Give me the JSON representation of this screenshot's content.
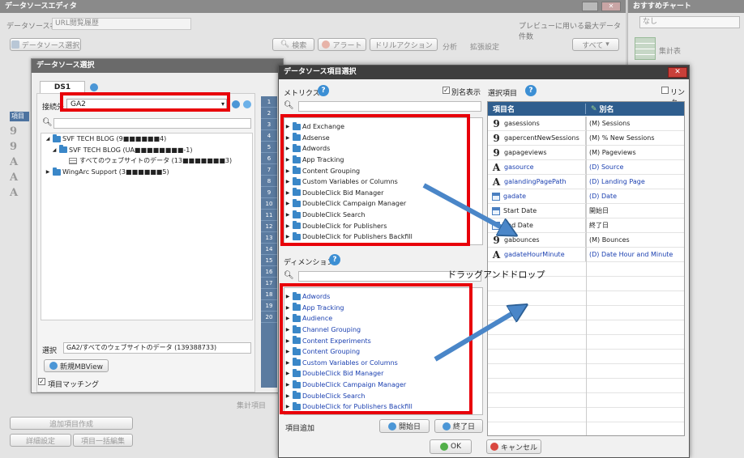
{
  "editor": {
    "title": "データソースエディタ",
    "ds_name_label": "データソース名",
    "ds_name_value": "URL閲覧履歴",
    "preview_label": "プレビューに用いる最大データ件数",
    "select_button": "データソース選択",
    "search_button": "検索",
    "alert_button": "アラート",
    "drill_button": "ドリルアクション",
    "analysis_label": "分析",
    "extend_label": "拡張設定",
    "all_label": "すべて",
    "add_item_button": "追加項目作成",
    "detail_button": "詳細設定",
    "bulk_edit_button": "項目一括編集",
    "agg_label": "集計項目"
  },
  "chart_panel": {
    "title": "おすすめチャート",
    "dropdown": "なし",
    "item_label": "集計表"
  },
  "ds_select": {
    "title": "データソース選択",
    "tab": "DS1",
    "connection_label": "接続先",
    "connection_value": "GA2",
    "tree": [
      {
        "label": "SVF TECH BLOG (9■■■■■■4)",
        "level": 0
      },
      {
        "label": "SVF TECH BLOG (UA■■■■■■■■-1)",
        "level": 1
      },
      {
        "label": "すべてのウェブサイトのデータ (13■■■■■■■3)",
        "level": 2
      },
      {
        "label": "WingArc Support (3■■■■■■5)",
        "level": 0
      }
    ],
    "selected_label": "選択",
    "selected_value": "GA2/すべてのウェブサイトのデータ (139388733)",
    "new_mbview_button": "新規MBView",
    "match_label": "項目マッチング",
    "left_item_label": "項目",
    "row_numbers": [
      "1",
      "2",
      "3",
      "4",
      "5",
      "6",
      "7",
      "8",
      "9",
      "10",
      "11",
      "12",
      "13",
      "14",
      "15",
      "16",
      "17",
      "18",
      "19",
      "20"
    ]
  },
  "item_select": {
    "title": "データソース項目選択",
    "metrics_label": "メトリクス",
    "alias_label": "別名表示",
    "dimension_label": "ディメンション",
    "metrics": [
      "Ad Exchange",
      "Adsense",
      "Adwords",
      "App Tracking",
      "Content Grouping",
      "Custom Variables or Columns",
      "DoubleClick Bid Manager",
      "DoubleClick Campaign Manager",
      "DoubleClick Search",
      "DoubleClick for Publishers",
      "DoubleClick for Publishers Backfill"
    ],
    "dimensions": [
      "Adwords",
      "App Tracking",
      "Audience",
      "Channel Grouping",
      "Content Experiments",
      "Content Grouping",
      "Custom Variables or Columns",
      "DoubleClick Bid Manager",
      "DoubleClick Campaign Manager",
      "DoubleClick Search",
      "DoubleClick for Publishers Backfill"
    ],
    "selected_label": "選択項目",
    "link_label": "リンク",
    "col_name": "項目名",
    "col_alias": "別名",
    "rows": [
      {
        "type": "num",
        "name": "gasessions",
        "alias": "(M) Sessions",
        "blue": false
      },
      {
        "type": "num",
        "name": "gapercentNewSessions",
        "alias": "(M) % New Sessions",
        "blue": false
      },
      {
        "type": "num",
        "name": "gapageviews",
        "alias": "(M) Pageviews",
        "blue": false
      },
      {
        "type": "str",
        "name": "gasource",
        "alias": "(D) Source",
        "blue": true
      },
      {
        "type": "str",
        "name": "galandingPagePath",
        "alias": "(D) Landing Page",
        "blue": true
      },
      {
        "type": "date",
        "name": "gadate",
        "alias": "(D) Date",
        "blue": true
      },
      {
        "type": "date",
        "name": "Start Date",
        "alias": "開始日",
        "blue": false
      },
      {
        "type": "date",
        "name": "End Date",
        "alias": "終了日",
        "blue": false
      },
      {
        "type": "num",
        "name": "gabounces",
        "alias": "(M) Bounces",
        "blue": false
      },
      {
        "type": "str",
        "name": "gadateHourMinute",
        "alias": "(D) Date Hour and Minute",
        "blue": true
      }
    ],
    "add_item_label": "項目追加",
    "start_date_button": "開始日",
    "end_date_button": "終了日",
    "ok_button": "OK",
    "cancel_button": "キャンセル"
  },
  "annotation": {
    "drag_drop": "ドラッグアンドドロップ"
  },
  "colors": {
    "red_highlight": "#e8000a",
    "arrow": "#4a86c8",
    "header_dark": "#2f5e8e"
  }
}
